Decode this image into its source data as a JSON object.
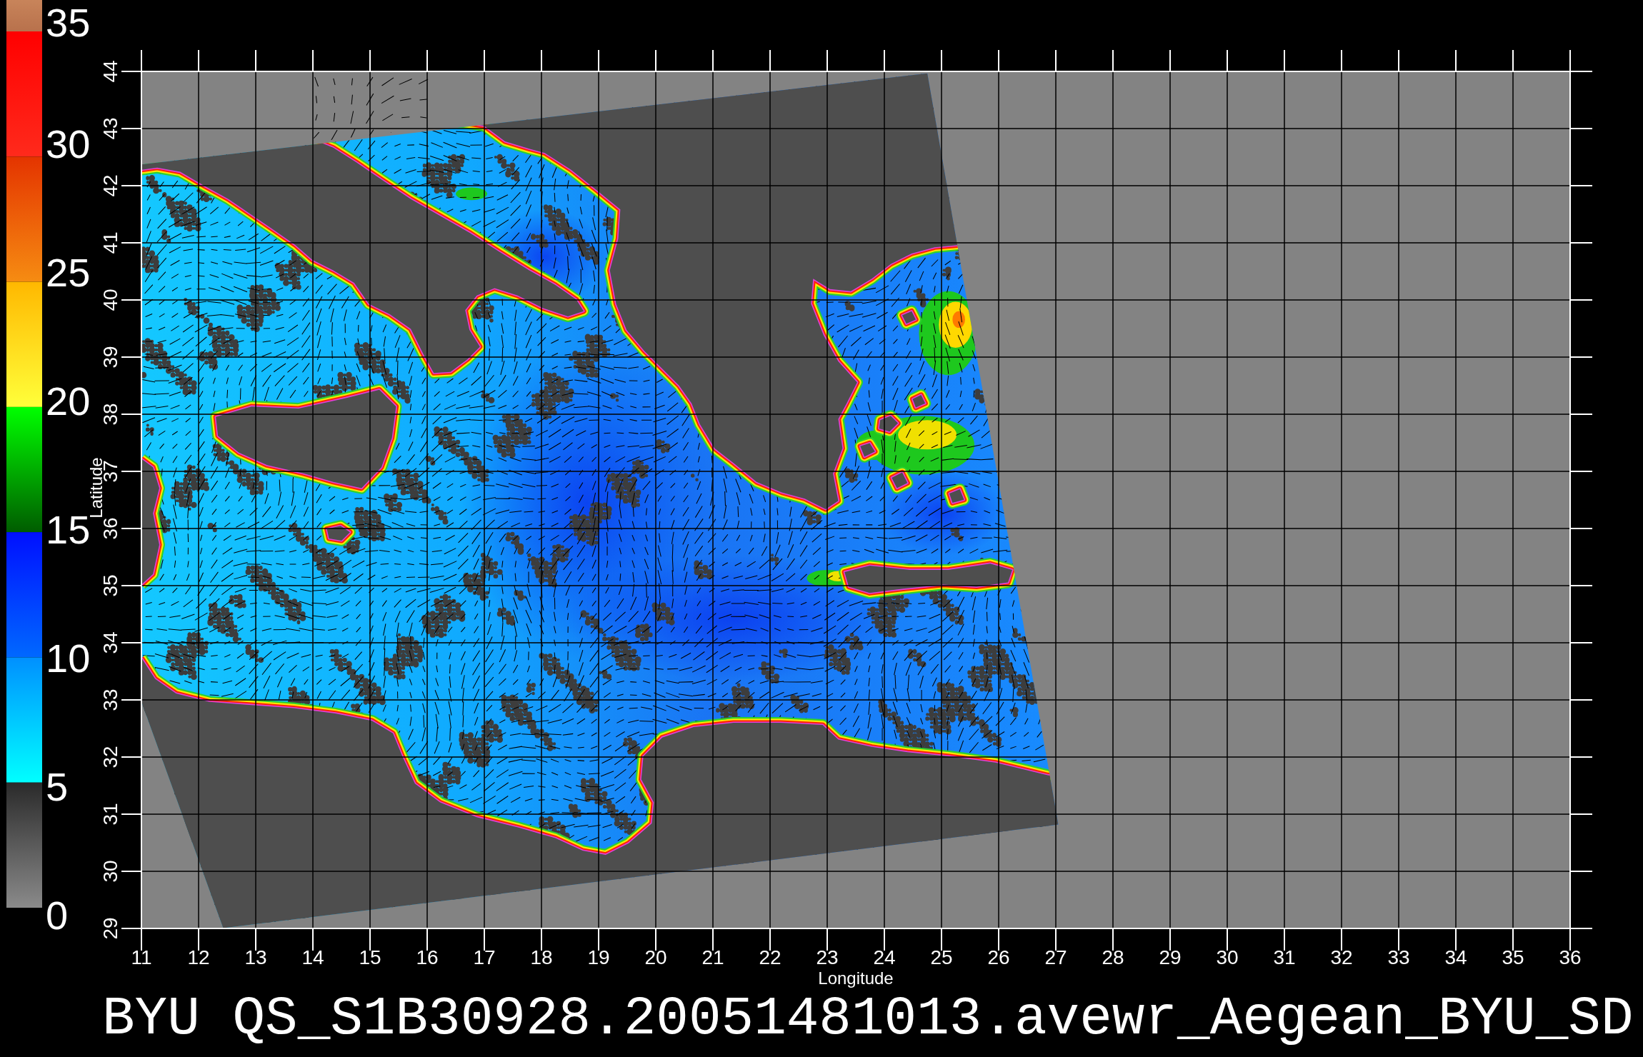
{
  "colorbar": {
    "segments": [
      {
        "stops": [
          {
            "color": "#c8845a"
          },
          {
            "color": "#b8714c"
          }
        ]
      },
      {
        "stops": [
          {
            "color": "#ff0000"
          },
          {
            "color": "#ff2a1c"
          }
        ]
      },
      {
        "stops": [
          {
            "color": "#e43400"
          },
          {
            "color": "#f68c12"
          }
        ]
      },
      {
        "stops": [
          {
            "color": "#ffb800"
          },
          {
            "color": "#ffff3a"
          }
        ]
      },
      {
        "stops": [
          {
            "color": "#00ff00"
          },
          {
            "color": "#005c00"
          }
        ]
      },
      {
        "stops": [
          {
            "color": "#0010ff"
          },
          {
            "color": "#0068ff"
          }
        ]
      },
      {
        "stops": [
          {
            "color": "#0090ff"
          },
          {
            "color": "#00ffff"
          }
        ]
      },
      {
        "stops": [
          {
            "color": "#2a2a2a"
          },
          {
            "color": "#8a8a8a"
          }
        ]
      }
    ],
    "labels": [
      "35",
      "30",
      "25",
      "20",
      "15",
      "10",
      "5",
      "0"
    ]
  },
  "map": {
    "latitude_ticks": [
      "44",
      "43",
      "42",
      "41",
      "40",
      "39",
      "38",
      "37",
      "36",
      "35",
      "34",
      "33",
      "32",
      "31",
      "30",
      "29"
    ],
    "longitude_ticks": [
      "11",
      "12",
      "13",
      "14",
      "15",
      "16",
      "17",
      "18",
      "19",
      "20",
      "21",
      "22",
      "23",
      "24",
      "25",
      "26",
      "27",
      "28",
      "29",
      "30",
      "31",
      "32",
      "33",
      "34",
      "35",
      "36"
    ],
    "x_title": "Longitude",
    "y_title": "Latitude"
  },
  "title": "BYU QS_S1B30928.20051481013.avewr_Aegean_BYU_SD"
}
